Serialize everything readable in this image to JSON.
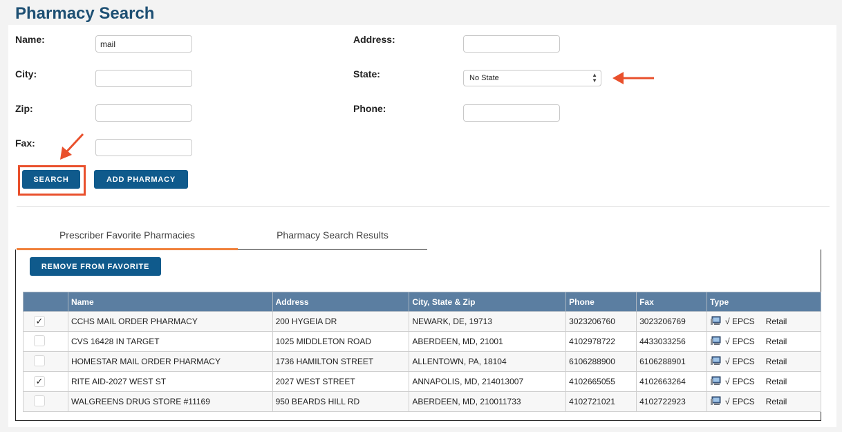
{
  "page": {
    "title": "Pharmacy Search"
  },
  "form": {
    "name_label": "Name:",
    "name_value": "mail",
    "city_label": "City:",
    "zip_label": "Zip:",
    "fax_label": "Fax:",
    "address_label": "Address:",
    "state_label": "State:",
    "state_value": "No State",
    "phone_label": "Phone:"
  },
  "buttons": {
    "search": "SEARCH",
    "add_pharmacy": "ADD PHARMACY",
    "remove_favorite": "REMOVE FROM FAVORITE"
  },
  "tabs": [
    {
      "label": "Prescriber Favorite Pharmacies",
      "active": true
    },
    {
      "label": "Pharmacy Search Results",
      "active": false
    }
  ],
  "table": {
    "headers": [
      "",
      "Name",
      "Address",
      "City, State & Zip",
      "Phone",
      "Fax",
      "Type"
    ],
    "rows": [
      {
        "checked": "✓",
        "name": "CCHS MAIL ORDER PHARMACY",
        "address": "200 HYGEIA DR",
        "city": "NEWARK, DE, 19713",
        "phone": "3023206760",
        "fax": "3023206769",
        "epcs": "√ EPCS",
        "type": "Retail"
      },
      {
        "checked": "",
        "name": "CVS 16428 IN TARGET",
        "address": "1025 MIDDLETON ROAD",
        "city": "ABERDEEN, MD, 21001",
        "phone": "4102978722",
        "fax": "4433033256",
        "epcs": "√ EPCS",
        "type": "Retail"
      },
      {
        "checked": "",
        "name": "HOMESTAR MAIL ORDER PHARMACY",
        "address": "1736 HAMILTON STREET",
        "city": "ALLENTOWN, PA, 18104",
        "phone": "6106288900",
        "fax": "6106288901",
        "epcs": "√ EPCS",
        "type": "Retail"
      },
      {
        "checked": "✓",
        "name": "RITE AID-2027 WEST ST",
        "address": "2027 WEST STREET",
        "city": "ANNAPOLIS, MD, 214013007",
        "phone": "4102665055",
        "fax": "4102663264",
        "epcs": "√ EPCS",
        "type": "Retail"
      },
      {
        "checked": "",
        "name": "WALGREENS DRUG STORE #11169",
        "address": "950 BEARDS HILL RD",
        "city": "ABERDEEN, MD, 210011733",
        "phone": "4102721021",
        "fax": "4102722923",
        "epcs": "√ EPCS",
        "type": "Retail"
      }
    ]
  },
  "colors": {
    "title": "#1d4f73",
    "button": "#0f5a8c",
    "table_header": "#5b7ea1",
    "tab_active_underline": "#f0813c",
    "annotation": "#e9502c"
  },
  "icons": [
    "monitor-icon",
    "arrow-annotation-icon"
  ]
}
